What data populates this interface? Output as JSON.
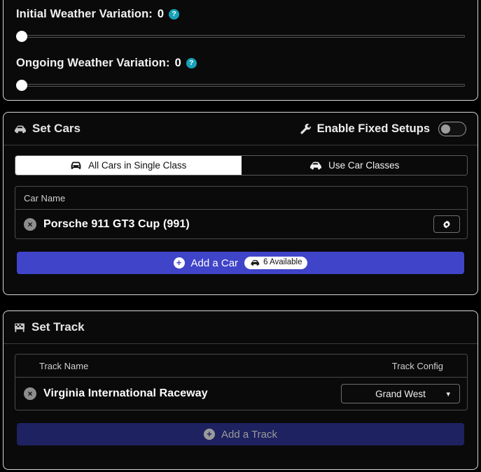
{
  "weather": {
    "initial": {
      "label_prefix": "Initial Weather Variation:",
      "value": "0",
      "help": "?"
    },
    "ongoing": {
      "label_prefix": "Ongoing Weather Variation:",
      "value": "0",
      "help": "?"
    }
  },
  "set_cars": {
    "title": "Set Cars",
    "title_icon": "car-side-icon",
    "fixed_setups": {
      "label": "Enable Fixed Setups",
      "icon": "wrench-icon",
      "enabled": false
    },
    "tabs": [
      {
        "label": "All Cars in Single Class",
        "icon": "car-front-icon",
        "active": true
      },
      {
        "label": "Use Car Classes",
        "icon": "car-side-icon",
        "active": false
      }
    ],
    "table": {
      "headers": [
        "Car Name"
      ],
      "rows": [
        {
          "name": "Porsche 911 GT3 Cup (991)",
          "remove_icon": "×",
          "settings_icon": "gear-icon"
        }
      ]
    },
    "add_button": {
      "label": "Add a Car",
      "plus": "+",
      "badge": "6 Available",
      "badge_icon": "car-side-icon",
      "disabled": false
    }
  },
  "set_track": {
    "title": "Set Track",
    "title_icon": "checkered-flag-icon",
    "table": {
      "headers": [
        "Track Name",
        "Track Config"
      ],
      "rows": [
        {
          "name": "Virginia International Raceway",
          "remove_icon": "×",
          "config": "Grand West"
        }
      ]
    },
    "add_button": {
      "label": "Add a Track",
      "plus": "+",
      "disabled": true
    }
  },
  "colors": {
    "accent_blue": "#4044c8",
    "accent_blue_disabled": "#1e2260",
    "help_teal": "#17a2b8",
    "panel_bg": "#0a0a0a",
    "page_bg": "#000000"
  }
}
